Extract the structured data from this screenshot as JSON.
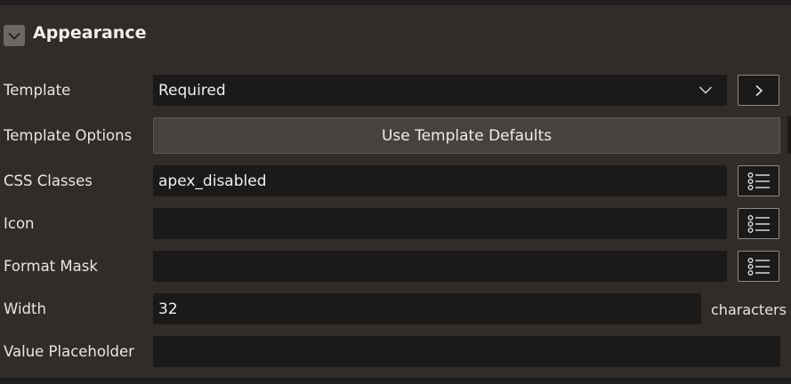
{
  "section": {
    "title": "Appearance",
    "toggle_icon": "chevron-down-icon"
  },
  "fields": {
    "template": {
      "label": "Template",
      "value": "Required",
      "dropdown_icon": "chevron-down-icon",
      "action_icon": "chevron-right-icon"
    },
    "template_options": {
      "label": "Template Options",
      "button_label": "Use Template Defaults"
    },
    "css_classes": {
      "label": "CSS Classes",
      "value": "apex_disabled",
      "action_icon": "list-icon"
    },
    "icon": {
      "label": "Icon",
      "value": "",
      "action_icon": "list-icon"
    },
    "format_mask": {
      "label": "Format Mask",
      "value": "",
      "action_icon": "list-icon"
    },
    "width": {
      "label": "Width",
      "value": "32",
      "suffix": "characters"
    },
    "value_placeholder": {
      "label": "Value Placeholder",
      "value": ""
    }
  },
  "colors": {
    "background": "#2f2c2a",
    "field_background": "#1c1a19",
    "button_background": "#45423f",
    "text": "#e8e6e3"
  }
}
